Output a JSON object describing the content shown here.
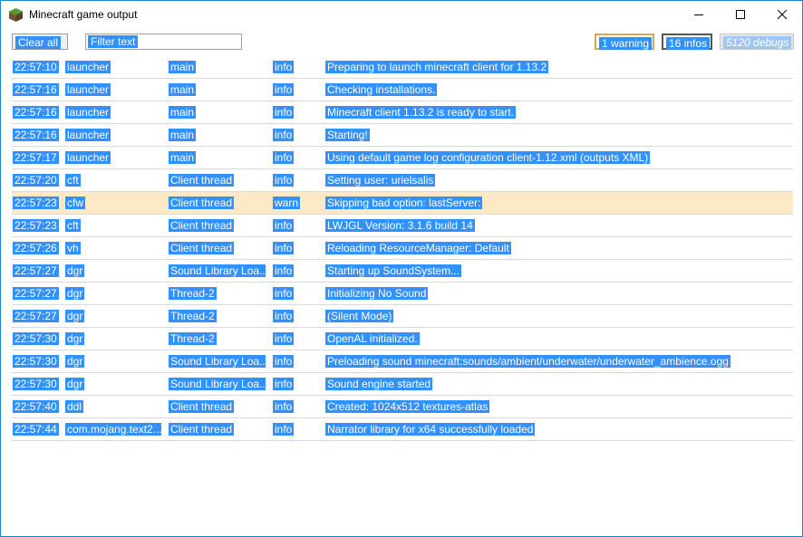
{
  "window": {
    "title": "Minecraft game output"
  },
  "toolbar": {
    "clear_label": "Clear all",
    "filter_value": "Filter text",
    "warnings_label": "1 warning",
    "infos_label": "16 infos",
    "debugs_label": "5120 debugs"
  },
  "log": {
    "rows": [
      {
        "time": "22:57:10",
        "source": "launcher",
        "thread": "main",
        "level": "info",
        "message": "Preparing to launch minecraft client for 1.13.2"
      },
      {
        "time": "22:57:16",
        "source": "launcher",
        "thread": "main",
        "level": "info",
        "message": "Checking installations."
      },
      {
        "time": "22:57:16",
        "source": "launcher",
        "thread": "main",
        "level": "info",
        "message": "Minecraft client 1.13.2 is ready to start."
      },
      {
        "time": "22:57:16",
        "source": "launcher",
        "thread": "main",
        "level": "info",
        "message": "Starting!"
      },
      {
        "time": "22:57:17",
        "source": "launcher",
        "thread": "main",
        "level": "info",
        "message": "Using default game log configuration client-1.12.xml (outputs XML)"
      },
      {
        "time": "22:57:20",
        "source": "cft",
        "thread": "Client thread",
        "level": "info",
        "message": "Setting user: urielsalis"
      },
      {
        "time": "22:57:23",
        "source": "cfw",
        "thread": "Client thread",
        "level": "warn",
        "message": "Skipping bad option: lastServer:"
      },
      {
        "time": "22:57:23",
        "source": "cft",
        "thread": "Client thread",
        "level": "info",
        "message": "LWJGL Version: 3.1.6 build 14"
      },
      {
        "time": "22:57:26",
        "source": "vh",
        "thread": "Client thread",
        "level": "info",
        "message": "Reloading ResourceManager: Default"
      },
      {
        "time": "22:57:27",
        "source": "dgr",
        "thread": "Sound Library Loa...",
        "level": "info",
        "message": "Starting up SoundSystem..."
      },
      {
        "time": "22:57:27",
        "source": "dgr",
        "thread": "Thread-2",
        "level": "info",
        "message": "Initializing No Sound"
      },
      {
        "time": "22:57:27",
        "source": "dgr",
        "thread": "Thread-2",
        "level": "info",
        "message": "(Silent Mode)"
      },
      {
        "time": "22:57:30",
        "source": "dgr",
        "thread": "Thread-2",
        "level": "info",
        "message": "OpenAL initialized."
      },
      {
        "time": "22:57:30",
        "source": "dgr",
        "thread": "Sound Library Loa...",
        "level": "info",
        "message": "Preloading sound minecraft:sounds/ambient/underwater/underwater_ambience.ogg"
      },
      {
        "time": "22:57:30",
        "source": "dgr",
        "thread": "Sound Library Loa...",
        "level": "info",
        "message": "Sound engine started"
      },
      {
        "time": "22:57:40",
        "source": "ddl",
        "thread": "Client thread",
        "level": "info",
        "message": "Created: 1024x512 textures-atlas"
      },
      {
        "time": "22:57:44",
        "source": "com.mojang.text2...",
        "thread": "Client thread",
        "level": "info",
        "message": "Narrator library for x64 successfully loaded"
      }
    ]
  },
  "colors": {
    "selection": "#3390ff",
    "warn_row": "#fde9c6",
    "border": "#1883d7"
  },
  "icons": [
    "minecraft-grass-icon",
    "minimize-icon",
    "maximize-icon",
    "close-icon"
  ]
}
